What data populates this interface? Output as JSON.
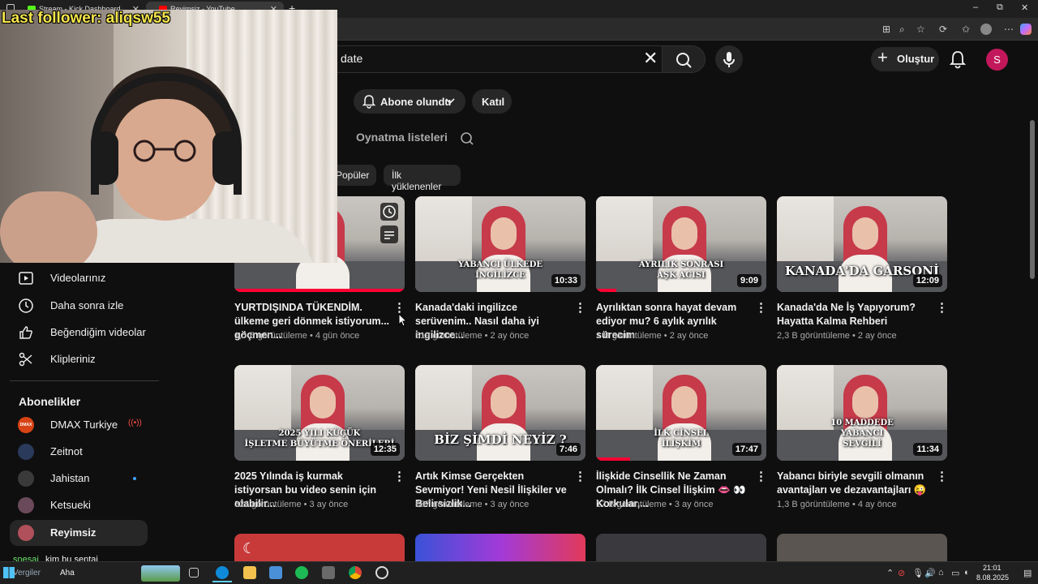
{
  "browser": {
    "tabs": [
      {
        "title": "Stream - Kick Dashboard",
        "icon": "kick-icon",
        "color": "#53fc18"
      },
      {
        "title": "Reyimsiz - YouTube",
        "icon": "youtube-icon",
        "color": "#ff0000"
      }
    ],
    "new_tab": "+",
    "window_controls": {
      "minimize": "–",
      "maximize": "⧉",
      "close": "✕"
    }
  },
  "header": {
    "search_text": "date",
    "create_label": "Oluştur",
    "avatar_letter": "S",
    "avatar_color": "#c2185b"
  },
  "channel": {
    "subscribed_label": "Abone olundu",
    "join_label": "Katıl",
    "tabs": {
      "videos_fragment": "r",
      "playlists": "Oynatma listeleri"
    },
    "chips": [
      "Popüler",
      "İlk yüklenenler"
    ]
  },
  "videos": [
    {
      "title": "YURTDIŞINDA TÜKENDİM. ülkeme geri dönmek istiyorum... göçmen...",
      "views": "1,5 B görüntüleme",
      "age": "4 gün önce",
      "duration": "",
      "caption": "",
      "progress": 1.0
    },
    {
      "title": "Kanada'daki ingilizce serüvenim.. Nasıl daha iyi ingilizce...",
      "views": "519 görüntüleme",
      "age": "2 ay önce",
      "duration": "10:33",
      "caption": "YABANCI ÜLKEDE\nİNGİLİZCE",
      "progress": 0
    },
    {
      "title": "Ayrılıktan sonra hayat devam ediyor mu? 6 aylık ayrılık sürecim",
      "views": "1 B görüntüleme",
      "age": "2 ay önce",
      "duration": "9:09",
      "caption": "AYRILIK SONRASI\nAŞK ACISI",
      "progress": 0.12
    },
    {
      "title": "Kanada'da Ne İş Yapıyorum? Hayatta Kalma Rehberi",
      "views": "2,3 B görüntüleme",
      "age": "2 ay önce",
      "duration": "12:09",
      "caption": "KANADA'DA GARSONİ",
      "progress": 0
    },
    {
      "title": "2025 Yılında iş kurmak istiyorsan bu video senin için olabilir...",
      "views": "326 görüntüleme",
      "age": "3 ay önce",
      "duration": "12:35",
      "caption": "2025 YILI KÜÇÜK\nİŞLETME BÜYÜTME ÖNERİLERİ",
      "progress": 0
    },
    {
      "title": "Artık Kimse Gerçekten Sevmiyor! Yeni Nesil İlişkiler ve Belirsizlik...",
      "views": "857 görüntüleme",
      "age": "3 ay önce",
      "duration": "7:46",
      "caption": "BİZ ŞİMDİ NEYİZ ?",
      "progress": 0
    },
    {
      "title": "İlişkide Cinsellik Ne Zaman Olmalı? İlk Cinsel İlişkim 👄 👀 Korkular,...",
      "views": "17 B görüntüleme",
      "age": "3 ay önce",
      "duration": "17:47",
      "caption": "İLK CİNSEL\nİLİŞKİM",
      "progress": 0.2
    },
    {
      "title": "Yabancı biriyle sevgili olmanın avantajları ve dezavantajları 😜",
      "views": "1,3 B görüntüleme",
      "age": "4 ay önce",
      "duration": "11:34",
      "caption": "10 MADDEDE\nYABANCI\nSEVGİLİ",
      "progress": 0
    }
  ],
  "sidebar": {
    "items": [
      {
        "label": "Videolarınız",
        "icon": "play-square-icon"
      },
      {
        "label": "Daha sonra izle",
        "icon": "clock-icon"
      },
      {
        "label": "Beğendiğim videolar",
        "icon": "thumbs-up-icon"
      },
      {
        "label": "Klipleriniz",
        "icon": "scissors-icon"
      }
    ],
    "subs_heading": "Abonelikler",
    "subscriptions": [
      {
        "label": "DMAX Turkiye",
        "color": "#d84315",
        "badge": "live",
        "avatar_text": "DMAX"
      },
      {
        "label": "Zeitnot",
        "color": "#2a3a5a",
        "badge": ""
      },
      {
        "label": "Jahistan",
        "color": "#3a3a3a",
        "badge": "new"
      },
      {
        "label": "Ketsueki",
        "color": "#6a4a5a",
        "badge": ""
      },
      {
        "label": "Reyimsiz",
        "color": "#b0505a",
        "badge": "",
        "selected": true
      }
    ]
  },
  "overlay": {
    "last_follower": "Last follower: aliqsw55",
    "chat_user": "snesai",
    "chat_text": "kim bu şentai"
  },
  "taskbar": {
    "widget_text": "Aha",
    "widget_sub": "Vergiler",
    "time": "21:01",
    "date": "8.08.2025"
  }
}
